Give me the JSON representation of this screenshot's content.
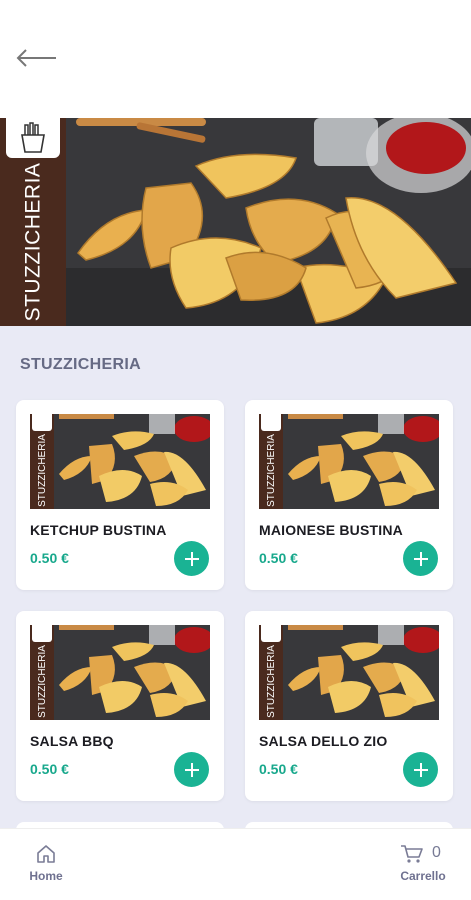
{
  "header": {
    "back_icon": "arrow-left-icon"
  },
  "hero": {
    "side_label": "STUZZICHERIA",
    "logo_icon": "fries-icon",
    "strip_color": "#4a2a1e"
  },
  "category": {
    "title": "STUZZICHERIA"
  },
  "products": [
    {
      "name": "KETCHUP BUSTINA",
      "price": "0.50 €",
      "thumb_label": "STUZZICHERIA"
    },
    {
      "name": "MAIONESE BUSTINA",
      "price": "0.50 €",
      "thumb_label": "STUZZICHERIA"
    },
    {
      "name": "SALSA BBQ",
      "price": "0.50 €",
      "thumb_label": "STUZZICHERIA"
    },
    {
      "name": "SALSA DELLO ZIO",
      "price": "0.50 €",
      "thumb_label": "STUZZICHERIA"
    }
  ],
  "colors": {
    "accent": "#1ab394",
    "price": "#18a88c",
    "background": "#e9eaf5",
    "nav_text": "#6f7190"
  },
  "bottom_nav": {
    "home_label": "Home",
    "home_icon": "home-icon",
    "cart_label": "Carrello",
    "cart_icon": "cart-icon",
    "cart_count": "0"
  }
}
